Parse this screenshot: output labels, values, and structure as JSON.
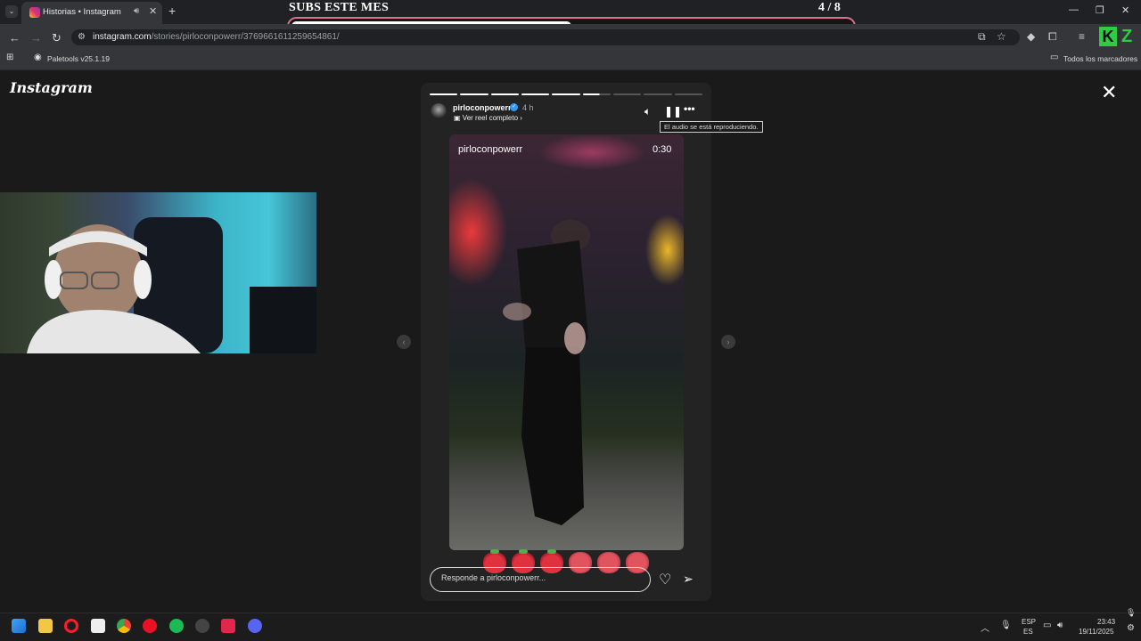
{
  "browser": {
    "tab_title": "Historias • Instagram",
    "url_main": "instagram.com",
    "url_path": "/stories/pirloconpowerr/3769661611259654861/",
    "bookmark_item": "Paletools v25.1.19",
    "bookmarks_all": "Todos los marcadores"
  },
  "overlay": {
    "title": "SUBS ESTE MES",
    "count": "4   / 8",
    "progress": 0.5
  },
  "instagram": {
    "logo": "Instagram",
    "story": {
      "username": "pirloconpowerr",
      "time_ago": "4 h",
      "reel_link": "Ver reel completo",
      "tooltip": "El audio se está reproduciendo.",
      "video_username": "pirloconpowerr",
      "video_time": "0:30",
      "segments_total": 9,
      "segments_done": 5,
      "current_progress": 0.6,
      "reply_placeholder": "Responde a pirloconpowerr..."
    }
  },
  "taskbar": {
    "lang_top": "ESP",
    "lang_bottom": "ES",
    "clock_time": "23:43",
    "clock_date": "19/11/2025"
  },
  "colors": {
    "overlay_border": "#d9728a",
    "kz_green": "#2ecc40",
    "verified_blue": "#3897f0"
  }
}
